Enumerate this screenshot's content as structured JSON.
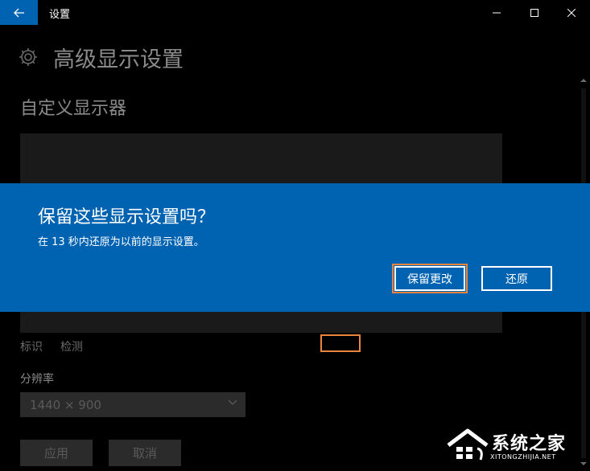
{
  "window": {
    "title": "设置"
  },
  "page": {
    "title": "高级显示设置",
    "section_title": "自定义显示器",
    "identify_link": "标识",
    "detect_link": "检测",
    "resolution_label": "分辨率",
    "resolution_value": "1440 × 900",
    "apply_label": "应用",
    "cancel_label": "取消"
  },
  "dialog": {
    "title": "保留这些显示设置吗？",
    "message": "在 13 秒内还原为以前的显示设置。",
    "keep_label": "保留更改",
    "revert_label": "还原"
  },
  "watermark": {
    "text": "系统之家",
    "subtext": "XITONGZHIJIA.NET"
  },
  "colors": {
    "accent": "#0063b1",
    "highlight": "#e8843c",
    "background": "#000000"
  },
  "icons": {
    "back": "arrow-left-icon",
    "gear": "gear-icon",
    "minimize": "minimize-icon",
    "maximize": "maximize-icon",
    "close": "close-icon",
    "dropdown": "chevron-down-icon"
  }
}
